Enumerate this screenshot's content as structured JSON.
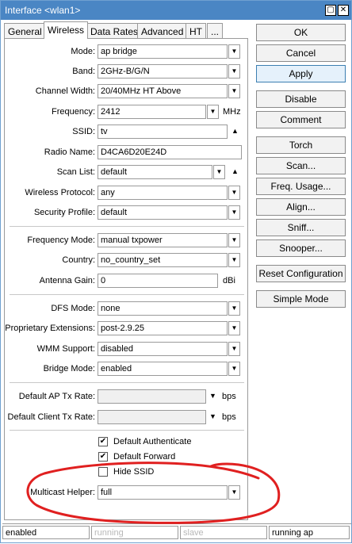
{
  "window": {
    "title": "Interface <wlan1>"
  },
  "tabs": [
    "General",
    "Wireless",
    "Data Rates",
    "Advanced",
    "HT",
    "..."
  ],
  "form": {
    "mode": {
      "label": "Mode:",
      "value": "ap bridge"
    },
    "band": {
      "label": "Band:",
      "value": "2GHz-B/G/N"
    },
    "channel_width": {
      "label": "Channel Width:",
      "value": "20/40MHz HT Above"
    },
    "frequency": {
      "label": "Frequency:",
      "value": "2412",
      "unit": "MHz"
    },
    "ssid": {
      "label": "SSID:",
      "value": "tv"
    },
    "radio_name": {
      "label": "Radio Name:",
      "value": "D4CA6D20E24D"
    },
    "scan_list": {
      "label": "Scan List:",
      "value": "default"
    },
    "wireless_protocol": {
      "label": "Wireless Protocol:",
      "value": "any"
    },
    "security_profile": {
      "label": "Security Profile:",
      "value": "default"
    },
    "frequency_mode": {
      "label": "Frequency Mode:",
      "value": "manual txpower"
    },
    "country": {
      "label": "Country:",
      "value": "no_country_set"
    },
    "antenna_gain": {
      "label": "Antenna Gain:",
      "value": "0",
      "unit": "dBi"
    },
    "dfs_mode": {
      "label": "DFS Mode:",
      "value": "none"
    },
    "proprietary_extensions": {
      "label": "Proprietary Extensions:",
      "value": "post-2.9.25"
    },
    "wmm_support": {
      "label": "WMM Support:",
      "value": "disabled"
    },
    "bridge_mode": {
      "label": "Bridge Mode:",
      "value": "enabled"
    },
    "default_ap_tx_rate": {
      "label": "Default AP Tx Rate:",
      "value": "",
      "unit": "bps"
    },
    "default_client_tx_rate": {
      "label": "Default Client Tx Rate:",
      "value": "",
      "unit": "bps"
    },
    "default_authenticate": {
      "label": "Default Authenticate",
      "checked": true
    },
    "default_forward": {
      "label": "Default Forward",
      "checked": true
    },
    "hide_ssid": {
      "label": "Hide SSID",
      "checked": false
    },
    "multicast_helper": {
      "label": "Multicast Helper:",
      "value": "full"
    }
  },
  "buttons": {
    "ok": "OK",
    "cancel": "Cancel",
    "apply": "Apply",
    "disable": "Disable",
    "comment": "Comment",
    "torch": "Torch",
    "scan": "Scan...",
    "freq_usage": "Freq. Usage...",
    "align": "Align...",
    "sniff": "Sniff...",
    "snooper": "Snooper...",
    "reset_configuration": "Reset Configuration",
    "simple_mode": "Simple Mode"
  },
  "status": {
    "enabled": "enabled",
    "running": "running",
    "slave": "slave",
    "running_ap": "running ap"
  },
  "colors": {
    "titlebar": "#4a86c4",
    "annotation": "#e02020"
  },
  "icons": {
    "dropdown": "dropdown-arrow-icon",
    "collapse": "up-triangle-icon",
    "expand": "down-triangle-icon"
  }
}
